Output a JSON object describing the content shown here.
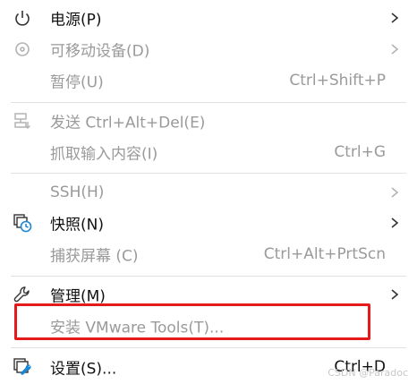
{
  "menu": {
    "power": {
      "label": "电源(P)"
    },
    "removable_devices": {
      "label": "可移动设备(D)"
    },
    "pause": {
      "label": "暂停(U)",
      "shortcut": "Ctrl+Shift+P"
    },
    "send_cad": {
      "label": "发送 Ctrl+Alt+Del(E)"
    },
    "grab_input": {
      "label": "抓取输入内容(I)",
      "shortcut": "Ctrl+G"
    },
    "ssh": {
      "label": "SSH(H)"
    },
    "snapshot": {
      "label": "快照(N)"
    },
    "capture_screen": {
      "label": "捕获屏幕 (C)",
      "shortcut": "Ctrl+Alt+PrtScn"
    },
    "manage": {
      "label": "管理(M)"
    },
    "install_tools": {
      "label": "安装 VMware Tools(T)..."
    },
    "settings": {
      "label": "设置(S)...",
      "shortcut": "Ctrl+D"
    }
  },
  "colors": {
    "highlight_border": "#e51a1a",
    "snapshot_clock": "#1a86d6",
    "settings_wrench": "#1a86d6"
  },
  "watermark": "CSDN @Paradoc"
}
